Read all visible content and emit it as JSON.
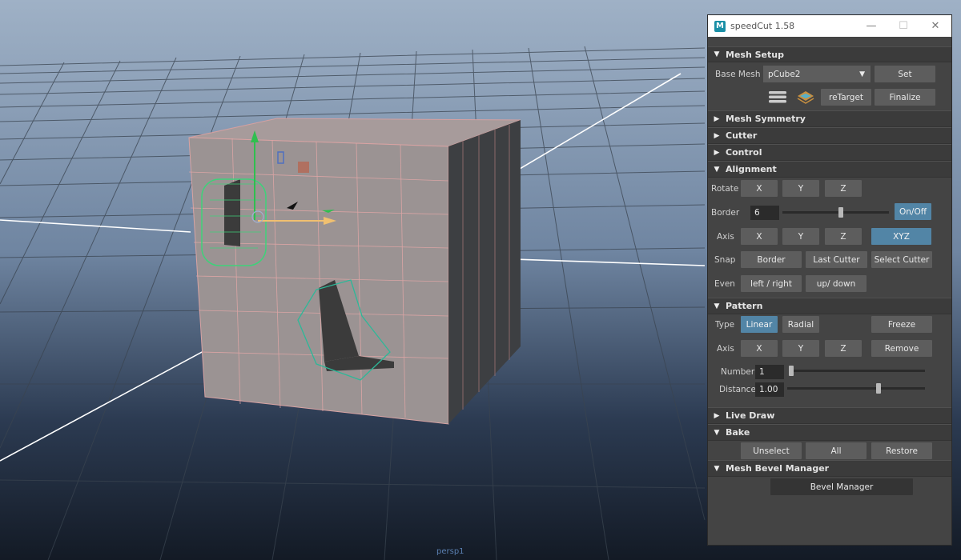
{
  "viewport": {
    "camera": "persp1"
  },
  "window": {
    "title": "speedCut 1.58",
    "icon_letter": "M",
    "controls": {
      "minimize": "—",
      "maximize": "☐",
      "close": "✕"
    }
  },
  "mesh_setup": {
    "title": "Mesh Setup",
    "base_mesh_label": "Base Mesh",
    "base_mesh_value": "pCube2",
    "set_label": "Set",
    "retarget_label": "reTarget",
    "finalize_label": "Finalize"
  },
  "collapsed": {
    "mesh_symmetry": "Mesh Symmetry",
    "cutter": "Cutter",
    "control": "Control"
  },
  "alignment": {
    "title": "Alignment",
    "rotate_label": "Rotate",
    "rotate_x": "X",
    "rotate_y": "Y",
    "rotate_z": "Z",
    "border_label": "Border",
    "border_value": "6",
    "border_slider": 0.55,
    "onoff_label": "On/Off",
    "axis_label": "Axis",
    "axis_x": "X",
    "axis_y": "Y",
    "axis_z": "Z",
    "axis_xyz": "XYZ",
    "snap_label": "Snap",
    "snap_border": "Border",
    "snap_last": "Last Cutter",
    "snap_select": "Select Cutter",
    "even_label": "Even",
    "even_lr": "left / right",
    "even_ud": "up/ down"
  },
  "pattern": {
    "title": "Pattern",
    "type_label": "Type",
    "linear": "Linear",
    "radial": "Radial",
    "freeze": "Freeze",
    "axis_label": "Axis",
    "axis_x": "X",
    "axis_y": "Y",
    "axis_z": "Z",
    "remove": "Remove",
    "number_label": "Number",
    "number_value": "1",
    "number_slider": 0.0,
    "distance_label": "Distance",
    "distance_value": "1.00",
    "distance_slider": 0.67
  },
  "live_draw": {
    "title": "Live Draw"
  },
  "bake": {
    "title": "Bake",
    "unselect": "Unselect",
    "all": "All",
    "restore": "Restore"
  },
  "bevel": {
    "title": "Mesh Bevel Manager",
    "button": "Bevel Manager"
  },
  "colors": {
    "accent": "#5285a6",
    "panel": "#444444",
    "button": "#5d5d5d",
    "header": "#3b3b3b"
  }
}
